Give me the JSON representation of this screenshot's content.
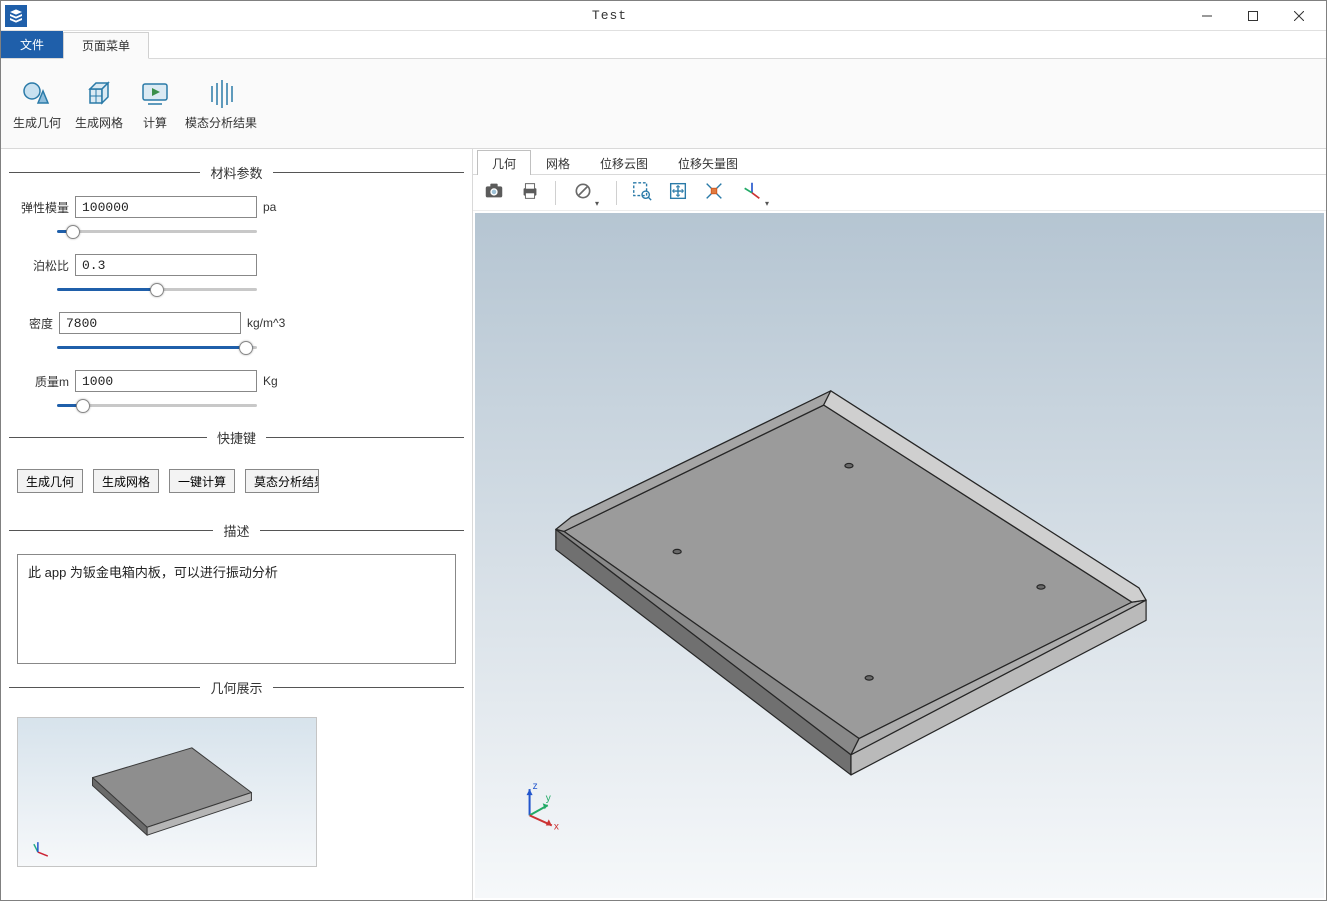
{
  "window": {
    "title": "Test"
  },
  "ribbon": {
    "file_tab": "文件",
    "page_menu_tab": "页面菜单",
    "items": [
      {
        "label": "生成几何",
        "icon": "shapes"
      },
      {
        "label": "生成网格",
        "icon": "cube"
      },
      {
        "label": "计算",
        "icon": "play"
      },
      {
        "label": "模态分析结果",
        "icon": "waves"
      }
    ]
  },
  "panel": {
    "material_group": "材料参数",
    "shortcuts_group": "快捷键",
    "description_group": "描述",
    "geometry_group": "几何展示",
    "params": {
      "elastic": {
        "label": "弹性模量",
        "value": "100000",
        "unit": "pa",
        "slider": 5
      },
      "poisson": {
        "label": "泊松比",
        "value": "0.3",
        "unit": "",
        "slider": 50
      },
      "density": {
        "label": "密度",
        "value": "7800",
        "unit": "kg/m^3",
        "slider": 98
      },
      "mass": {
        "label": "质量m",
        "value": "1000",
        "unit": "Kg",
        "slider": 10
      }
    },
    "shortcuts": [
      "生成几何",
      "生成网格",
      "一键计算",
      "莫态分析结果"
    ],
    "description": "此 app 为钣金电箱内板，可以进行振动分析"
  },
  "view": {
    "tabs": [
      "几何",
      "网格",
      "位移云图",
      "位移矢量图"
    ],
    "active_tab_index": 0
  }
}
